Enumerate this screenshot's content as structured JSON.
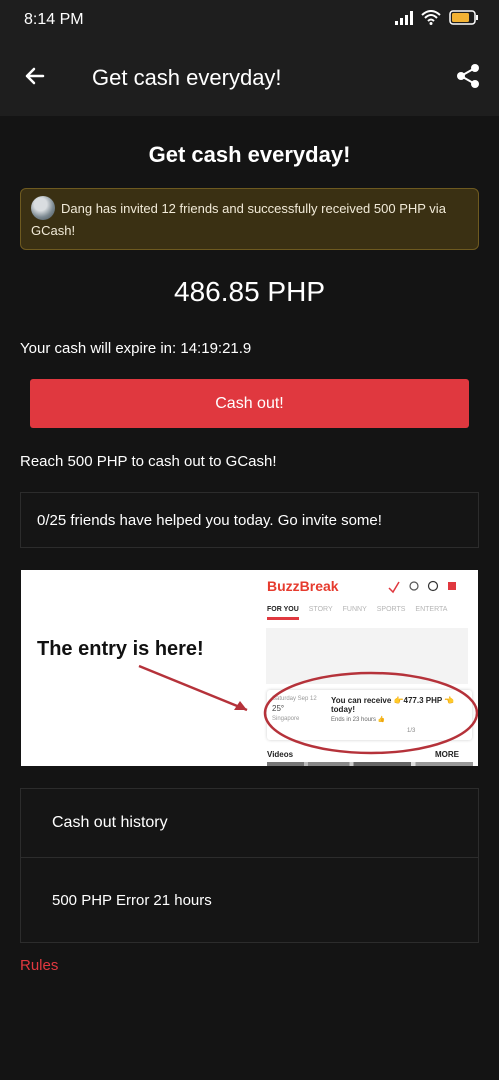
{
  "status_bar": {
    "time": "8:14 PM",
    "icons": [
      "signal-icon",
      "wifi-icon",
      "battery-icon"
    ]
  },
  "app_bar": {
    "title": "Get cash everyday!",
    "back_icon": "arrow-left-icon",
    "share_icon": "share-icon"
  },
  "main": {
    "heading": "Get cash everyday!",
    "invite_banner": "Dang has invited 12 friends and successfully received 500 PHP via GCash!",
    "amount": "486.85 PHP",
    "expire_label": "Your cash will expire in:",
    "expire_time": "14:19:21.9",
    "cashout_button": "Cash out!",
    "reach_text": "Reach 500 PHP to cash out to GCash!",
    "friends_text": "0/25 friends have helped you today. Go invite some!"
  },
  "promo": {
    "entry_text": "The entry is here!",
    "logo": "BuzzBreak",
    "tabs": [
      "FOR YOU",
      "STORY",
      "FUNNY",
      "SPORTS",
      "ENTERTA"
    ],
    "weather_date": "Saturday Sep 12",
    "weather_temp": "25°",
    "weather_city": "Singapore",
    "receive_text": "You can receive 👉477.3 PHP 👈today!",
    "ends_text": "Ends in 23 hours 👍",
    "pager": "1/3",
    "videos": "Videos",
    "more": "MORE"
  },
  "history": {
    "title": "Cash out history",
    "rows": [
      {
        "amount": "500 PHP",
        "status": "Error",
        "time": "21 hours"
      }
    ]
  },
  "rules_link": "Rules",
  "colors": {
    "accent": "#e0383f",
    "background": "#141414",
    "bar": "#1e1e1e",
    "banner": "#3a3013"
  }
}
